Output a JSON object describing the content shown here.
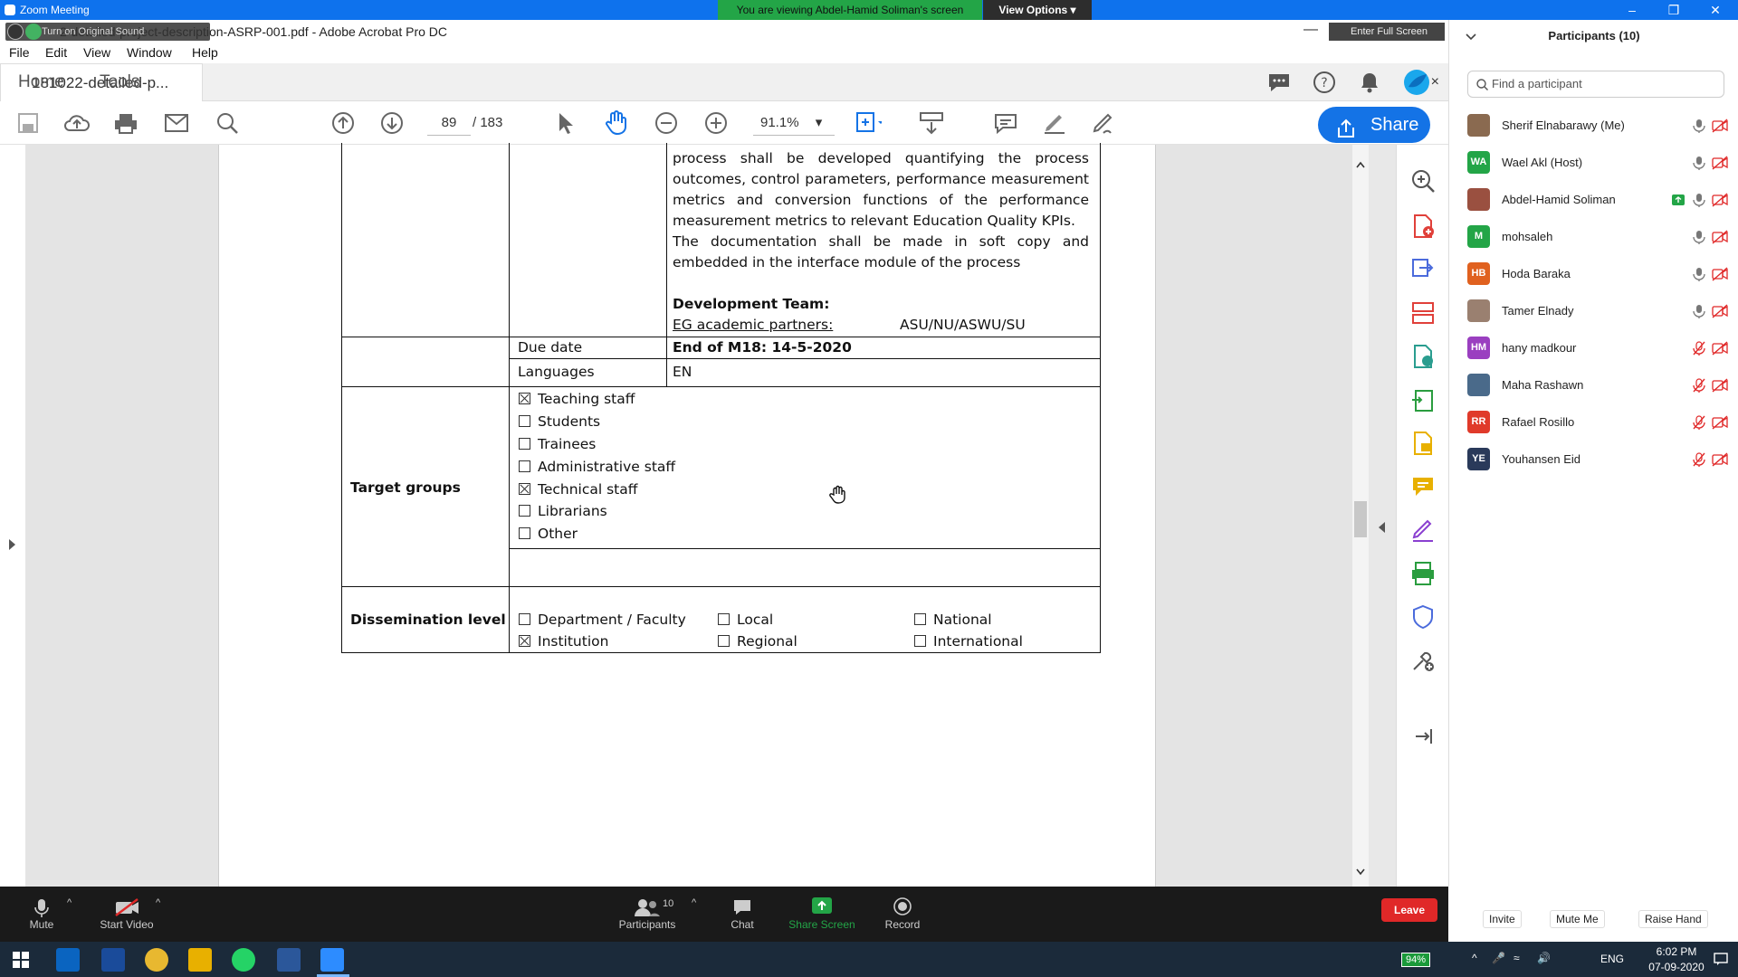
{
  "zoom": {
    "title": "Zoom Meeting",
    "banner": "You are viewing Abdel-Hamid Soliman's screen",
    "view_options": "View Options",
    "original_sound": "Turn on Original Sound",
    "enter_full_screen": "Enter Full Screen"
  },
  "acrobat": {
    "title": "2-detailed-project-description-ASRP-001.pdf - Adobe Acrobat Pro DC",
    "menu": [
      "File",
      "Edit",
      "View",
      "Window",
      "Help"
    ],
    "tabs": {
      "home": "Home",
      "tools": "Tools",
      "document": "181022-detailed-p...",
      "close": "×"
    },
    "page_current": "89",
    "page_total": "/ 183",
    "zoom": "91.1%",
    "share": "Share"
  },
  "pdf": {
    "process_lines": [
      "process shall be developed quantifying the process",
      "outcomes, control parameters, performance measurement",
      "metrics and conversion functions of the performance",
      "measurement metrics to relevant Education Quality KPIs.",
      "The documentation shall be made in soft copy and",
      "embedded in the interface module of the process"
    ],
    "dev_team_label": "Development Team:",
    "partners_label": "EG academic partners:",
    "partners_value": "ASU/NU/ASWU/SU",
    "due_date_label": "Due date",
    "due_date_value": "End of M18: 14-5-2020",
    "languages_label": "Languages",
    "languages_value": "EN",
    "target_groups_label": "Target groups",
    "target_groups": [
      {
        "label": "Teaching staff",
        "checked": true
      },
      {
        "label": "Students",
        "checked": false
      },
      {
        "label": "Trainees",
        "checked": false
      },
      {
        "label": "Administrative staff",
        "checked": false
      },
      {
        "label": "Technical staff",
        "checked": true
      },
      {
        "label": "Librarians",
        "checked": false
      },
      {
        "label": "Other",
        "checked": false
      }
    ],
    "dissemination_label": "Dissemination level",
    "dissemination": {
      "department": "Department / Faculty",
      "institution": "Institution",
      "local": "Local",
      "regional": "Regional",
      "national": "National",
      "international": "International"
    }
  },
  "participants": {
    "title": "Participants (10)",
    "search_placeholder": "Find a participant",
    "list": [
      {
        "name": "Sherif Elnabarawy (Me)",
        "initials": "",
        "color": "#8a6a50",
        "muted": false
      },
      {
        "name": "Wael Akl (Host)",
        "initials": "WA",
        "color": "#23a547",
        "muted": false
      },
      {
        "name": "Abdel-Hamid Soliman",
        "initials": "",
        "color": "#9a5040",
        "muted": false
      },
      {
        "name": "mohsaleh",
        "initials": "M",
        "color": "#23a547",
        "muted": false
      },
      {
        "name": "Hoda Baraka",
        "initials": "HB",
        "color": "#e0611f",
        "muted": false
      },
      {
        "name": "Tamer Elnady",
        "initials": "",
        "color": "#9a8070",
        "muted": false
      },
      {
        "name": "hany madkour",
        "initials": "HM",
        "color": "#9a3fc0",
        "muted": true
      },
      {
        "name": "Maha Rashawn",
        "initials": "",
        "color": "#4a6a8a",
        "muted": true
      },
      {
        "name": "Rafael Rosillo",
        "initials": "RR",
        "color": "#e03a2a",
        "muted": true
      },
      {
        "name": "Youhansen Eid",
        "initials": "YE",
        "color": "#2a3a5a",
        "muted": true
      }
    ],
    "invite": "Invite",
    "mute_me": "Mute Me",
    "raise_hand": "Raise Hand"
  },
  "zoom_bar": {
    "mute": "Mute",
    "start_video": "Start Video",
    "participants": "Participants",
    "participants_count": "10",
    "chat": "Chat",
    "share_screen": "Share Screen",
    "record": "Record",
    "leave": "Leave"
  },
  "taskbar": {
    "battery": "94%",
    "lang": "ENG",
    "time": "6:02 PM",
    "date": "07-09-2020"
  },
  "colors": {
    "zoom_blue": "#0e72ed",
    "zoom_green": "#23a547",
    "acrobat_blue": "#1473e6",
    "leave_red": "#e02828"
  }
}
